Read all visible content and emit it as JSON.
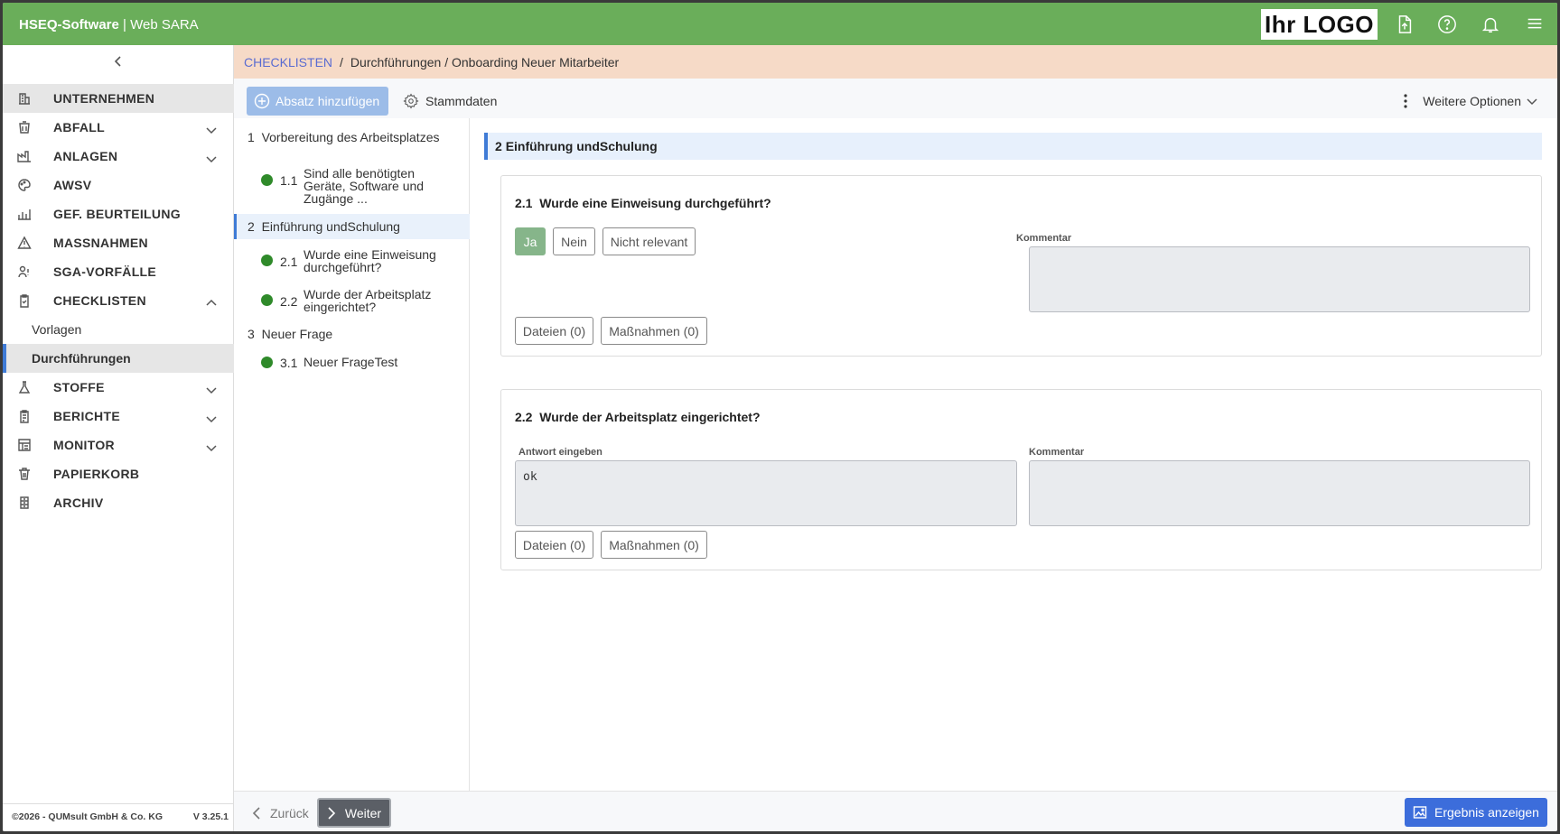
{
  "header": {
    "brand_bold": "HSEQ-Software",
    "brand_sep": " | ",
    "brand_rest": "Web SARA",
    "logo_text": "Ihr LOGO",
    "icons": [
      "file-upload-icon",
      "help-icon",
      "bell-icon",
      "menu-icon"
    ],
    "bg_color": "#6aae5a"
  },
  "sidebar": {
    "items": [
      {
        "label": "UNTERNEHMEN",
        "icon": "building-icon",
        "expandable": false,
        "active": true
      },
      {
        "label": "ABFALL",
        "icon": "waste-icon",
        "expandable": true
      },
      {
        "label": "ANLAGEN",
        "icon": "factory-icon",
        "expandable": true
      },
      {
        "label": "AWSV",
        "icon": "palette-icon",
        "expandable": false
      },
      {
        "label": "GEF. BEURTEILUNG",
        "icon": "chart-bars-icon",
        "expandable": false
      },
      {
        "label": "MASSNAHMEN",
        "icon": "warning-icon",
        "expandable": false
      },
      {
        "label": "SGA-VORFÄLLE",
        "icon": "user-incident-icon",
        "expandable": false
      },
      {
        "label": "CHECKLISTEN",
        "icon": "clipboard-check-icon",
        "expandable": true,
        "expanded": true
      }
    ],
    "checklisten_sub": [
      {
        "label": "Vorlagen",
        "active": false
      },
      {
        "label": "Durchführungen",
        "active": true
      }
    ],
    "items_after": [
      {
        "label": "STOFFE",
        "icon": "flask-icon",
        "expandable": true
      },
      {
        "label": "BERICHTE",
        "icon": "report-icon",
        "expandable": true
      },
      {
        "label": "MONITOR",
        "icon": "monitor-icon",
        "expandable": true
      },
      {
        "label": "PAPIERKORB",
        "icon": "trash-icon",
        "expandable": false
      },
      {
        "label": "ARCHIV",
        "icon": "archive-icon",
        "expandable": false
      }
    ],
    "copyright": "©2026 - QUMsult GmbH & Co. KG",
    "version": "V 3.25.1"
  },
  "breadcrumb": {
    "link": "CHECKLISTEN",
    "sep": "/",
    "rest": "Durchführungen / Onboarding Neuer Mitarbeiter"
  },
  "toolbar": {
    "add_label": "Absatz hinzufügen",
    "stamm_label": "Stammdaten",
    "more_label": "Weitere Optionen"
  },
  "tree": {
    "sections": [
      {
        "num": "1",
        "title": "Vorbereitung des Arbeitsplatzes",
        "questions": [
          {
            "num": "1.1",
            "text": "Sind alle benötigten Geräte, Software und Zugänge ..."
          }
        ]
      },
      {
        "num": "2",
        "title": "Einführung undSchulung",
        "active": true,
        "questions": [
          {
            "num": "2.1",
            "text": "Wurde eine Einweisung durchgeführt?"
          },
          {
            "num": "2.2",
            "text": "Wurde der Arbeitsplatz eingerichtet?"
          }
        ]
      },
      {
        "num": "3",
        "title": "Neuer Frage",
        "questions": [
          {
            "num": "3.1",
            "text": "Neuer FrageTest"
          }
        ]
      }
    ]
  },
  "content": {
    "section_num": "2",
    "section_title": "Einführung undSchulung",
    "q1": {
      "num": "2.1",
      "title": "Wurde eine Einweisung durchgeführt?",
      "options": [
        "Ja",
        "Nein",
        "Nicht relevant"
      ],
      "selected": "Ja",
      "comment_label": "Kommentar",
      "comment_value": "",
      "files_label": "Dateien (0)",
      "measures_label": "Maßnahmen (0)"
    },
    "q2": {
      "num": "2.2",
      "title": "Wurde der Arbeitsplatz eingerichtet?",
      "answer_label": "Antwort eingeben",
      "answer_value": "ok",
      "comment_label": "Kommentar",
      "comment_value": "",
      "files_label": "Dateien (0)",
      "measures_label": "Maßnahmen (0)"
    }
  },
  "bottombar": {
    "back_label": "Zurück",
    "next_label": "Weiter",
    "result_label": "Ergebnis anzeigen"
  }
}
